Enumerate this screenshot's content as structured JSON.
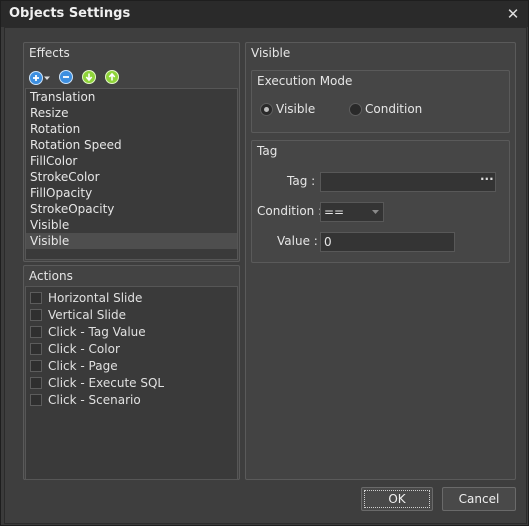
{
  "window": {
    "title": "Objects Settings",
    "close_glyph": "✕"
  },
  "effects": {
    "title": "Effects",
    "toolbar": [
      {
        "icon": "add-icon",
        "color": "#3d8fe0"
      },
      {
        "icon": "remove-icon",
        "color": "#3d8fe0"
      },
      {
        "icon": "move-down-icon",
        "color": "#8fd43a"
      },
      {
        "icon": "move-up-icon",
        "color": "#8fd43a"
      }
    ],
    "items": [
      "Translation",
      "Resize",
      "Rotation",
      "Rotation Speed",
      "FillColor",
      "StrokeColor",
      "FillOpacity",
      "StrokeOpacity",
      "Visible",
      "Visible"
    ],
    "selected_index": 9
  },
  "actions": {
    "title": "Actions",
    "items": [
      "Horizontal Slide",
      "Vertical Slide",
      "Click - Tag Value",
      "Click - Color",
      "Click - Page",
      "Click - Execute SQL",
      "Click - Scenario"
    ]
  },
  "detail": {
    "title": "Visible",
    "execution_mode": {
      "title": "Execution Mode",
      "options": [
        "Visible",
        "Condition"
      ],
      "selected": "Visible"
    },
    "tag": {
      "title": "Tag",
      "tag_label": "Tag :",
      "tag_value": "",
      "browse_label": "···",
      "condition_label": "Condition :",
      "condition_value": "==",
      "value_label": "Value :",
      "value_value": "0"
    }
  },
  "buttons": {
    "ok": "OK",
    "cancel": "Cancel"
  }
}
